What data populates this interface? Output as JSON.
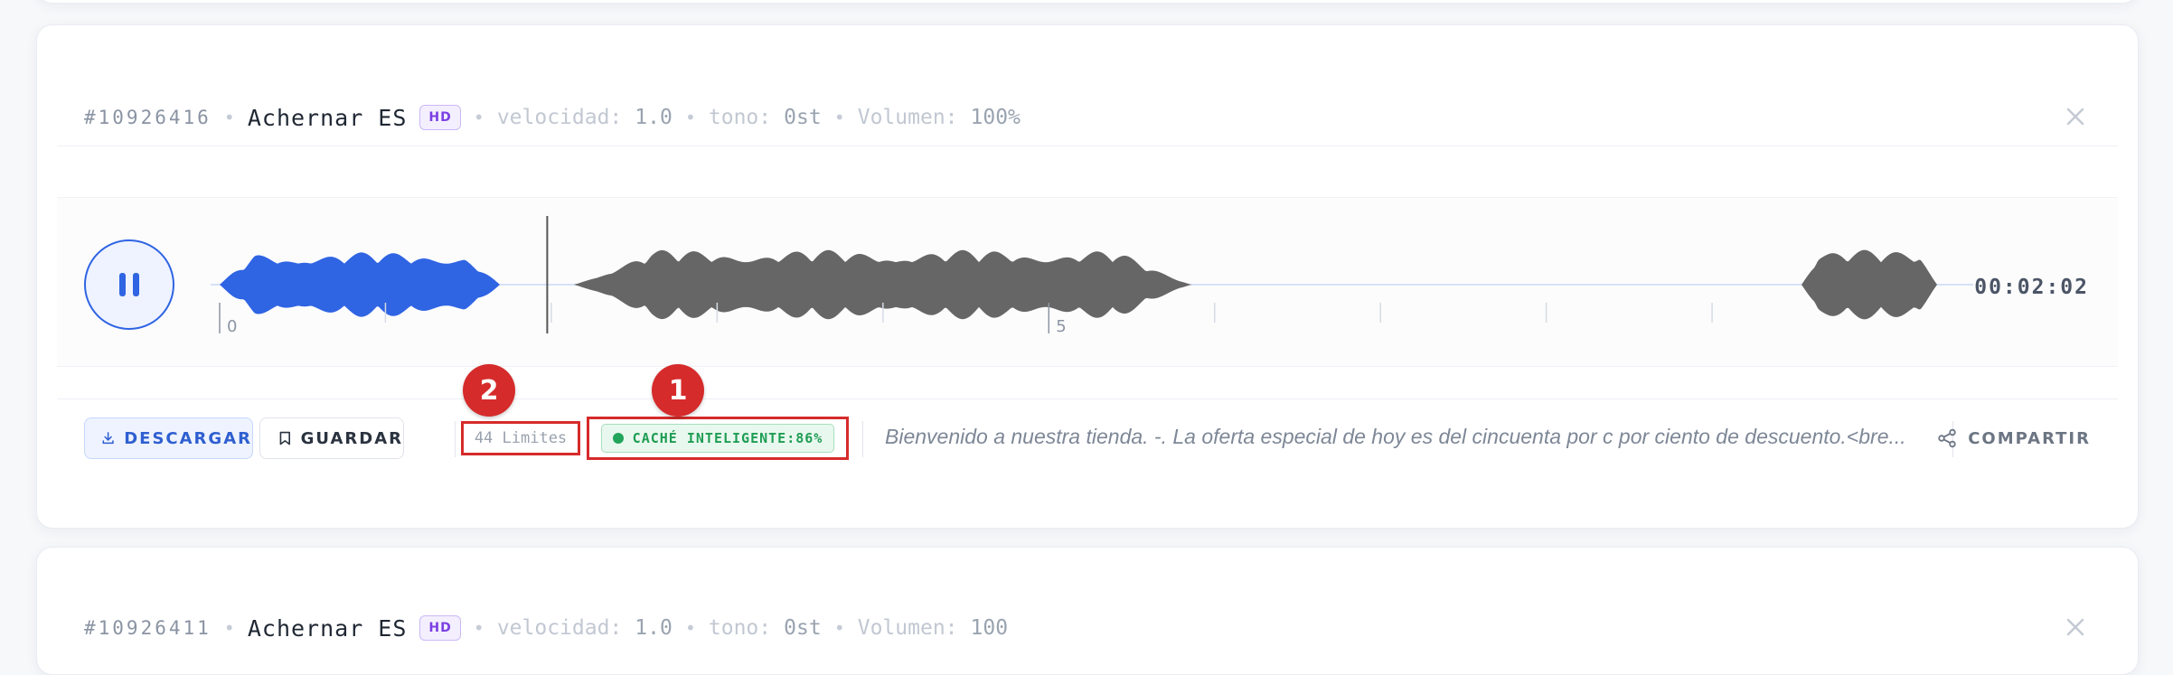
{
  "cards": [
    {
      "id": "#10926416",
      "voice": "Achernar ES",
      "quality_badge": "HD",
      "speed_label": "velocidad:",
      "speed_value": "1.0",
      "pitch_label": "tono:",
      "pitch_value": "0st",
      "volume_label": "Volumen:",
      "volume_value": "100%",
      "duration": "00:02:02",
      "timeline_labels": [
        "0",
        "5"
      ],
      "playback_progress": 0.19,
      "download_label": "DESCARGAR",
      "save_label": "GUARDAR",
      "limits_label": "44 Limites",
      "cache_label": "CACHÉ INTELIGENTE:86%",
      "transcript": "Bienvenido a nuestra tienda. -. La oferta especial de hoy es del cincuenta por c por ciento de descuento.<bre...",
      "share_label": "COMPARTIR"
    },
    {
      "id": "#10926411",
      "voice": "Achernar ES",
      "quality_badge": "HD",
      "speed_label": "velocidad:",
      "speed_value": "1.0",
      "pitch_label": "tono:",
      "pitch_value": "0st",
      "volume_label": "Volumen:",
      "volume_value": "100"
    }
  ],
  "annotations": [
    "1",
    "2"
  ],
  "colors": {
    "accent": "#2f64e3",
    "played_wave": "#2f64e3",
    "unplayed_wave": "#666666",
    "highlight": "#d62b2b",
    "cache_green": "#1f9d53"
  },
  "icons": {
    "play_state": "pause-icon",
    "download": "download-icon",
    "save": "bookmark-icon",
    "share": "share-icon",
    "close": "close-icon"
  }
}
